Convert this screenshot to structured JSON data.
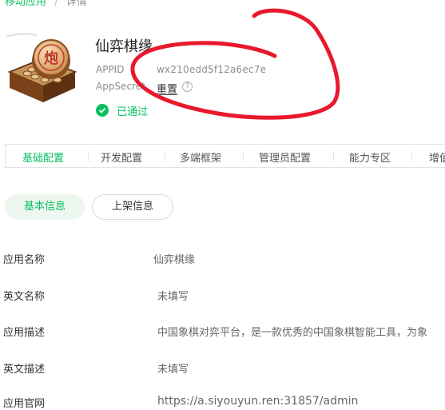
{
  "breadcrumb": {
    "parent": "移动应用",
    "separator": "/",
    "current": "详情"
  },
  "app": {
    "name": "仙弈棋缘",
    "appid_label": "APPID",
    "appid_value": "wx210edd5f12a6ec7e",
    "appsecret_label": "AppSecret",
    "reset_label": "重置",
    "help_glyph": "?",
    "status_text": "已通过",
    "icon_glyph": "炮",
    "icon_name": "chinese-chess-icon"
  },
  "tabs": [
    {
      "label": "基础配置",
      "active": true
    },
    {
      "label": "开发配置",
      "active": false
    },
    {
      "label": "多端框架",
      "active": false
    },
    {
      "label": "管理员配置",
      "active": false
    },
    {
      "label": "能力专区",
      "active": false
    },
    {
      "label": "增值",
      "active": false
    }
  ],
  "sub_tabs": [
    {
      "label": "基本信息",
      "active": true
    },
    {
      "label": "上架信息",
      "active": false
    }
  ],
  "info_rows": [
    {
      "label": "应用名称",
      "value": "仙弈棋缘"
    },
    {
      "label": "英文名称",
      "value": "未填写"
    },
    {
      "label": "应用描述",
      "value": "中国象棋对弈平台，是一款优秀的中国象棋智能工具，为象"
    },
    {
      "label": "英文描述",
      "value": "未填写"
    },
    {
      "label": "应用官网",
      "value": "https://a.siyouyun.ren:31857/admin"
    }
  ],
  "colors": {
    "accent": "#07c160",
    "annotation": "#e8192c"
  }
}
